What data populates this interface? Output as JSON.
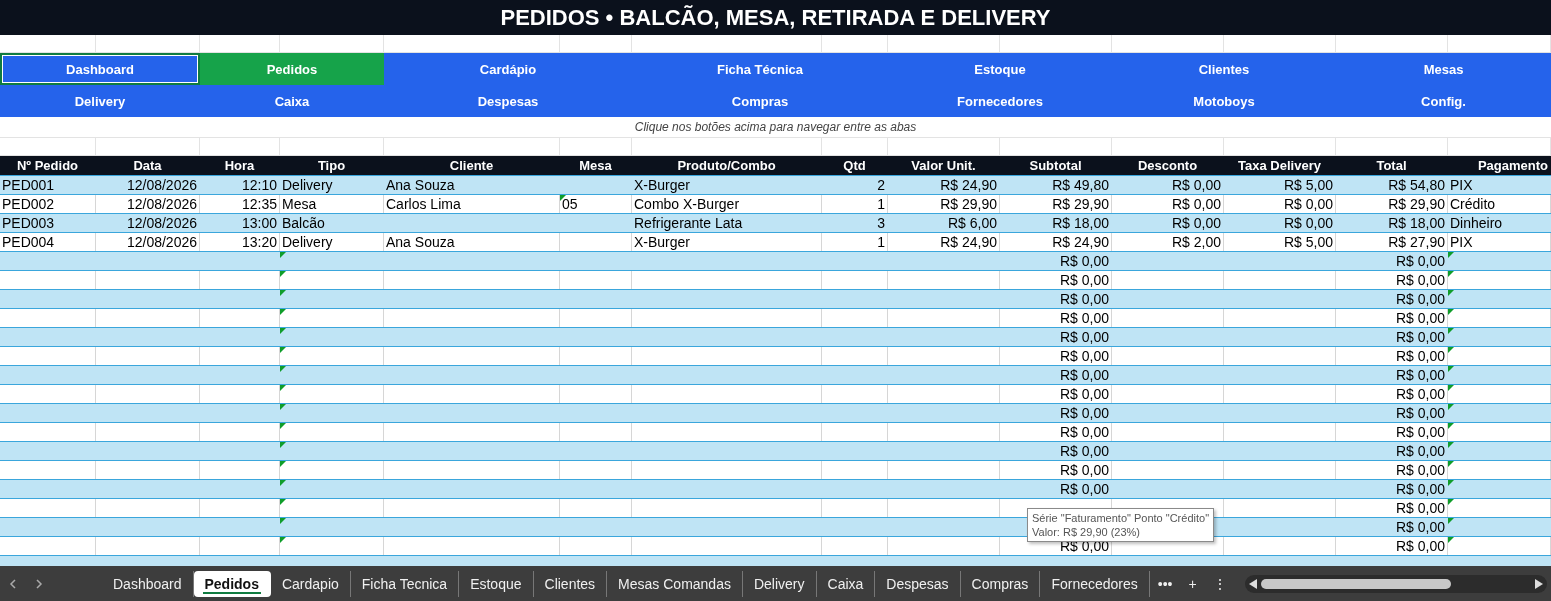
{
  "window": {
    "title": "PEDIDOS • BALCÃO, MESA, RETIRADA E DELIVERY"
  },
  "nav": {
    "buttons": [
      {
        "label": "Dashboard",
        "selected": false
      },
      {
        "label": "Pedidos",
        "selected": true
      },
      {
        "label": "Cardápio",
        "selected": false
      },
      {
        "label": "Ficha Técnica",
        "selected": false
      },
      {
        "label": "Estoque",
        "selected": false
      },
      {
        "label": "Clientes",
        "selected": false
      },
      {
        "label": "Mesas",
        "selected": false
      },
      {
        "label": "Delivery",
        "selected": false
      },
      {
        "label": "Caixa",
        "selected": false
      },
      {
        "label": "Despesas",
        "selected": false
      },
      {
        "label": "Compras",
        "selected": false
      },
      {
        "label": "Fornecedores",
        "selected": false
      },
      {
        "label": "Motoboys",
        "selected": false
      },
      {
        "label": "Config.",
        "selected": false
      }
    ],
    "hint": "Clique nos botões acima para navegar entre as abas"
  },
  "table": {
    "columns": [
      "Nº Pedido",
      "Data",
      "Hora",
      "Tipo",
      "Cliente",
      "Mesa",
      "Produto/Combo",
      "Qtd",
      "Valor Unit.",
      "Subtotal",
      "Desconto",
      "Taxa Delivery",
      "Total",
      "Pagamento"
    ],
    "rows": [
      {
        "cells": [
          "PED001",
          "12/08/2026",
          "12:10",
          "Delivery",
          "Ana Souza",
          "",
          "X-Burger",
          "2",
          "R$ 24,90",
          "R$ 49,80",
          "R$ 0,00",
          "R$ 5,00",
          "R$ 54,80",
          "PIX"
        ],
        "tipo_flag": false,
        "mesa_flag": false,
        "pagamento_flag": false
      },
      {
        "cells": [
          "PED002",
          "12/08/2026",
          "12:35",
          "Mesa",
          "Carlos Lima",
          "05",
          "Combo X-Burger",
          "1",
          "R$ 29,90",
          "R$ 29,90",
          "R$ 0,00",
          "R$ 0,00",
          "R$ 29,90",
          "Crédito"
        ],
        "tipo_flag": false,
        "mesa_flag": true,
        "pagamento_flag": false
      },
      {
        "cells": [
          "PED003",
          "12/08/2026",
          "13:00",
          "Balcão",
          "",
          "",
          "Refrigerante Lata",
          "3",
          "R$ 6,00",
          "R$ 18,00",
          "R$ 0,00",
          "R$ 0,00",
          "R$ 18,00",
          "Dinheiro"
        ],
        "tipo_flag": false,
        "mesa_flag": false,
        "pagamento_flag": false
      },
      {
        "cells": [
          "PED004",
          "12/08/2026",
          "13:20",
          "Delivery",
          "Ana Souza",
          "",
          "X-Burger",
          "1",
          "R$ 24,90",
          "R$ 24,90",
          "R$ 2,00",
          "R$ 5,00",
          "R$ 27,90",
          "PIX"
        ],
        "tipo_flag": false,
        "mesa_flag": false,
        "pagamento_flag": false
      },
      {
        "cells": [
          "",
          "",
          "",
          "",
          "",
          "",
          "",
          "",
          "",
          "R$ 0,00",
          "",
          "",
          "R$ 0,00",
          ""
        ],
        "tipo_flag": true,
        "mesa_flag": false,
        "pagamento_flag": true
      },
      {
        "cells": [
          "",
          "",
          "",
          "",
          "",
          "",
          "",
          "",
          "",
          "R$ 0,00",
          "",
          "",
          "R$ 0,00",
          ""
        ],
        "tipo_flag": true,
        "mesa_flag": false,
        "pagamento_flag": true
      },
      {
        "cells": [
          "",
          "",
          "",
          "",
          "",
          "",
          "",
          "",
          "",
          "R$ 0,00",
          "",
          "",
          "R$ 0,00",
          ""
        ],
        "tipo_flag": true,
        "mesa_flag": false,
        "pagamento_flag": true
      },
      {
        "cells": [
          "",
          "",
          "",
          "",
          "",
          "",
          "",
          "",
          "",
          "R$ 0,00",
          "",
          "",
          "R$ 0,00",
          ""
        ],
        "tipo_flag": true,
        "mesa_flag": false,
        "pagamento_flag": true
      },
      {
        "cells": [
          "",
          "",
          "",
          "",
          "",
          "",
          "",
          "",
          "",
          "R$ 0,00",
          "",
          "",
          "R$ 0,00",
          ""
        ],
        "tipo_flag": true,
        "mesa_flag": false,
        "pagamento_flag": true
      },
      {
        "cells": [
          "",
          "",
          "",
          "",
          "",
          "",
          "",
          "",
          "",
          "R$ 0,00",
          "",
          "",
          "R$ 0,00",
          ""
        ],
        "tipo_flag": true,
        "mesa_flag": false,
        "pagamento_flag": true
      },
      {
        "cells": [
          "",
          "",
          "",
          "",
          "",
          "",
          "",
          "",
          "",
          "R$ 0,00",
          "",
          "",
          "R$ 0,00",
          ""
        ],
        "tipo_flag": true,
        "mesa_flag": false,
        "pagamento_flag": true
      },
      {
        "cells": [
          "",
          "",
          "",
          "",
          "",
          "",
          "",
          "",
          "",
          "R$ 0,00",
          "",
          "",
          "R$ 0,00",
          ""
        ],
        "tipo_flag": true,
        "mesa_flag": false,
        "pagamento_flag": true
      },
      {
        "cells": [
          "",
          "",
          "",
          "",
          "",
          "",
          "",
          "",
          "",
          "R$ 0,00",
          "",
          "",
          "R$ 0,00",
          ""
        ],
        "tipo_flag": true,
        "mesa_flag": false,
        "pagamento_flag": true
      },
      {
        "cells": [
          "",
          "",
          "",
          "",
          "",
          "",
          "",
          "",
          "",
          "R$ 0,00",
          "",
          "",
          "R$ 0,00",
          ""
        ],
        "tipo_flag": true,
        "mesa_flag": false,
        "pagamento_flag": true
      },
      {
        "cells": [
          "",
          "",
          "",
          "",
          "",
          "",
          "",
          "",
          "",
          "R$ 0,00",
          "",
          "",
          "R$ 0,00",
          ""
        ],
        "tipo_flag": true,
        "mesa_flag": false,
        "pagamento_flag": true
      },
      {
        "cells": [
          "",
          "",
          "",
          "",
          "",
          "",
          "",
          "",
          "",
          "R$ 0,00",
          "",
          "",
          "R$ 0,00",
          ""
        ],
        "tipo_flag": true,
        "mesa_flag": false,
        "pagamento_flag": true
      },
      {
        "cells": [
          "",
          "",
          "",
          "",
          "",
          "",
          "",
          "",
          "",
          "R$ 0,00",
          "",
          "",
          "R$ 0,00",
          ""
        ],
        "tipo_flag": true,
        "mesa_flag": false,
        "pagamento_flag": true
      },
      {
        "cells": [
          "",
          "",
          "",
          "",
          "",
          "",
          "",
          "",
          "",
          "",
          "",
          "",
          "R$ 0,00",
          ""
        ],
        "tipo_flag": true,
        "mesa_flag": false,
        "pagamento_flag": true
      },
      {
        "cells": [
          "",
          "",
          "",
          "",
          "",
          "",
          "",
          "",
          "",
          "",
          "",
          "",
          "R$ 0,00",
          ""
        ],
        "tipo_flag": true,
        "mesa_flag": false,
        "pagamento_flag": true
      },
      {
        "cells": [
          "",
          "",
          "",
          "",
          "",
          "",
          "",
          "",
          "",
          "R$ 0,00",
          "",
          "",
          "R$ 0,00",
          ""
        ],
        "tipo_flag": true,
        "mesa_flag": false,
        "pagamento_flag": true
      }
    ]
  },
  "tooltip": {
    "lines": [
      "Série \"Faturamento\" Ponto \"Crédito\"",
      "Valor: R$ 29,90 (23%)"
    ]
  },
  "sheet_tabs": {
    "tabs": [
      {
        "label": "Dashboard",
        "selected": false
      },
      {
        "label": "Pedidos",
        "selected": true
      },
      {
        "label": "Cardapio",
        "selected": false
      },
      {
        "label": "Ficha Tecnica",
        "selected": false
      },
      {
        "label": "Estoque",
        "selected": false
      },
      {
        "label": "Clientes",
        "selected": false
      },
      {
        "label": "Mesas Comandas",
        "selected": false
      },
      {
        "label": "Delivery",
        "selected": false
      },
      {
        "label": "Caixa",
        "selected": false
      },
      {
        "label": "Despesas",
        "selected": false
      },
      {
        "label": "Compras",
        "selected": false
      },
      {
        "label": "Fornecedores",
        "selected": false
      }
    ],
    "more": "•••",
    "add": "+",
    "menu": "⋮"
  }
}
